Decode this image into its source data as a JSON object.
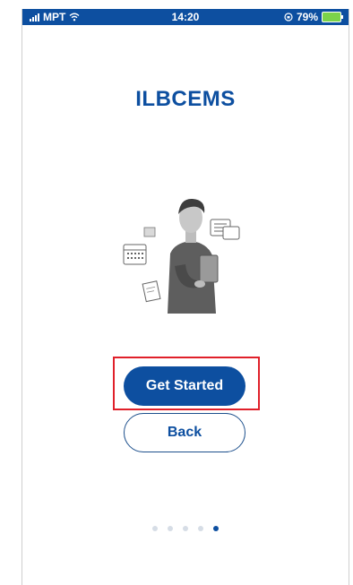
{
  "status_bar": {
    "carrier": "MPT",
    "time": "14:20",
    "battery": "79%"
  },
  "app": {
    "title": "ILBCEMS"
  },
  "buttons": {
    "get_started": "Get Started",
    "back": "Back"
  },
  "pager": {
    "total": 5,
    "active_index": 4
  },
  "colors": {
    "primary": "#0d4fa0",
    "highlight": "#e0202a",
    "dot_inactive": "#d6dde6"
  }
}
